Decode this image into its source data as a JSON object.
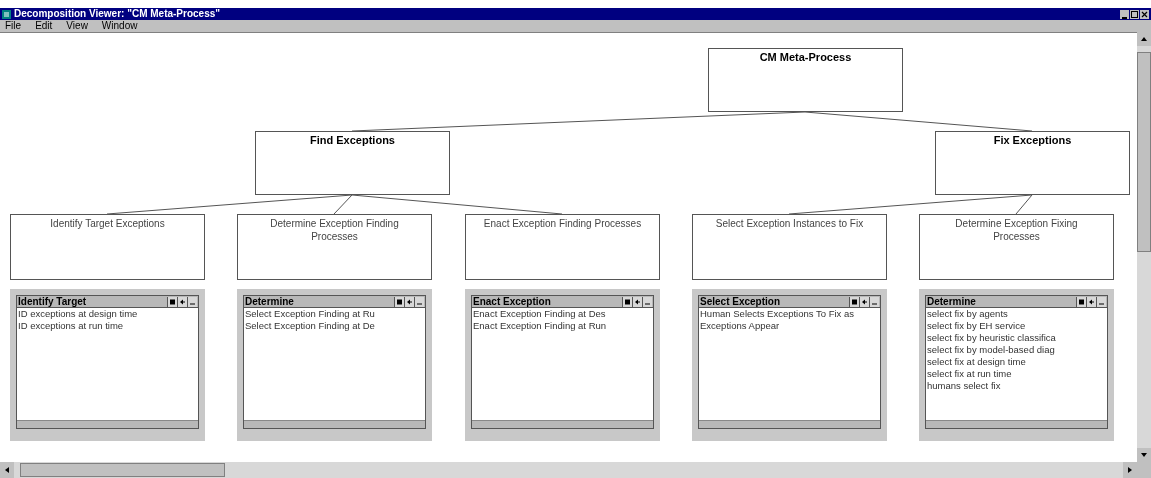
{
  "window": {
    "title": "Decomposition Viewer: \"CM Meta-Process\""
  },
  "menu": [
    {
      "label": "File"
    },
    {
      "label": "Edit"
    },
    {
      "label": "View"
    },
    {
      "label": "Window"
    }
  ],
  "diagram": {
    "root": {
      "label": "CM Meta-Process",
      "children": [
        {
          "label": "Find Exceptions",
          "children": [
            {
              "label": "Identify Target Exceptions",
              "panel": {
                "title": "Identify Target",
                "items": [
                  "ID exceptions at design time",
                  "ID exceptions at run time"
                ]
              }
            },
            {
              "label": "Determine Exception Finding Processes",
              "panel": {
                "title": "Determine",
                "items": [
                  "Select Exception Finding at Ru",
                  "Select Exception Finding at De"
                ]
              }
            },
            {
              "label": "Enact Exception Finding Processes",
              "panel": {
                "title": "Enact Exception",
                "items": [
                  "Enact Exception Finding at Des",
                  "Enact Exception Finding at Run"
                ]
              }
            }
          ]
        },
        {
          "label": "Fix Exceptions",
          "children": [
            {
              "label": "Select Exception Instances to Fix",
              "panel": {
                "title": "Select Exception",
                "items": [
                  "Human Selects Exceptions To Fix as Exceptions Appear"
                ]
              }
            },
            {
              "label": "Determine Exception Fixing Processes",
              "panel": {
                "title": "Determine",
                "items": [
                  "select fix by agents",
                  "select fix by EH service",
                  "select fix by heuristic classifica",
                  "select fix by model-based diag",
                  "select fix at design time",
                  "select fix at run time",
                  "humans select fix"
                ]
              }
            }
          ]
        }
      ]
    }
  }
}
